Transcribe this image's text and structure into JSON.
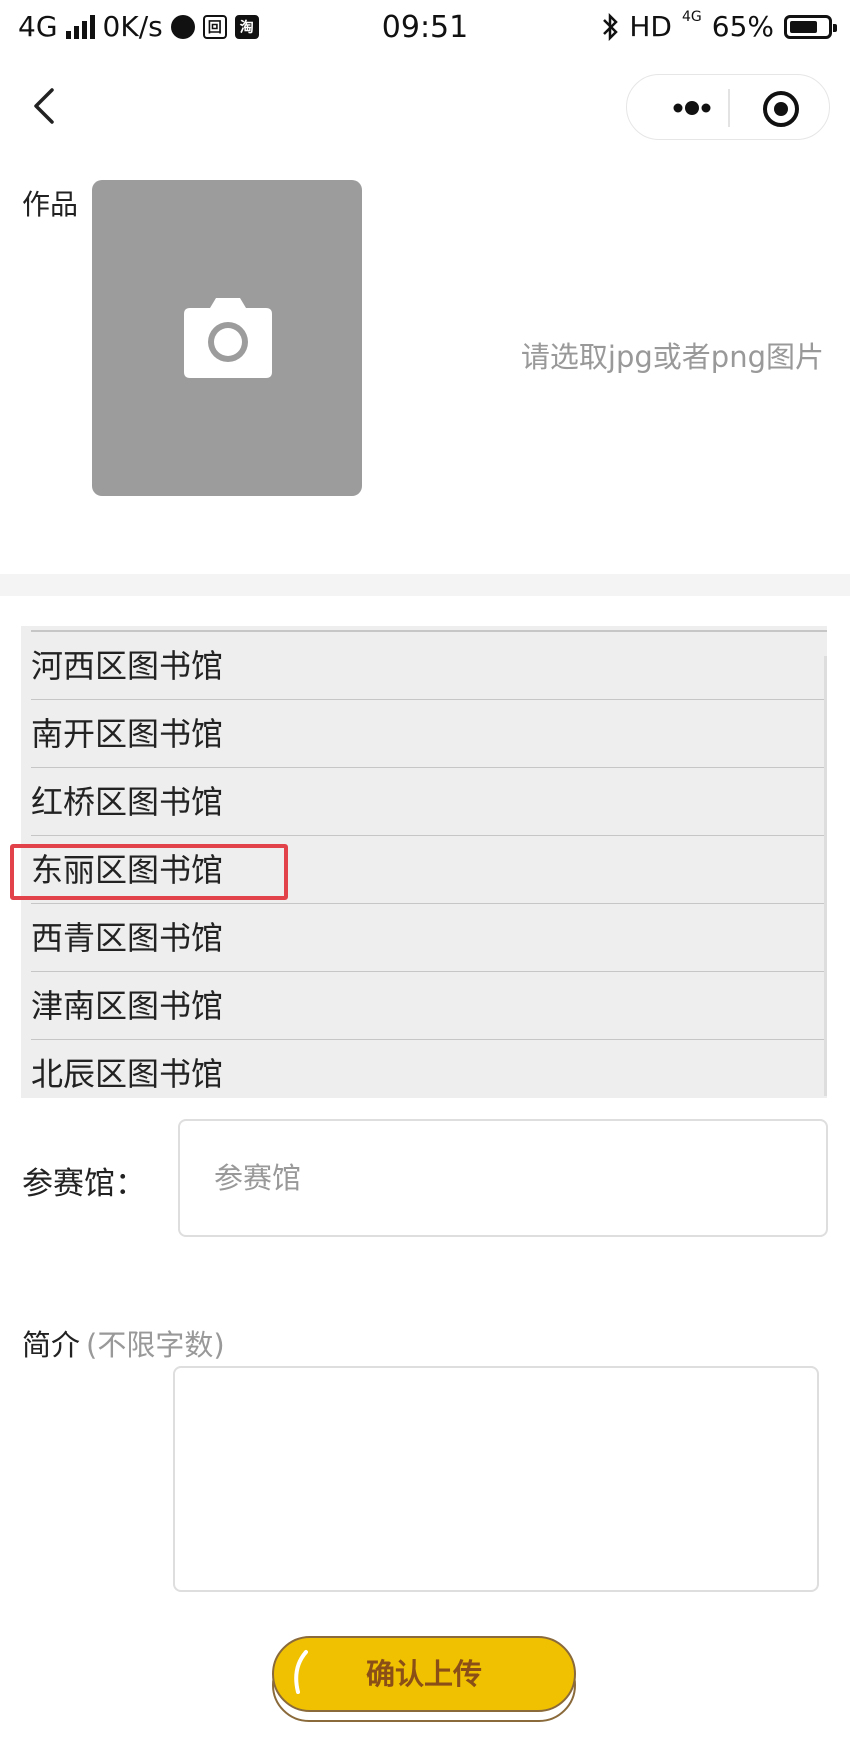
{
  "status_bar": {
    "network": "4G",
    "speed": "0K/s",
    "app_badge_1": "回",
    "app_badge_2": "淘",
    "time": "09:51",
    "hd": "HD",
    "net_small": "4G",
    "battery": "65%"
  },
  "upload": {
    "label": "作品",
    "hint": "请选取jpg或者png图片"
  },
  "picker": {
    "items": [
      "河西区图书馆",
      "南开区图书馆",
      "红桥区图书馆",
      "东丽区图书馆",
      "西青区图书馆",
      "津南区图书馆",
      "北辰区图书馆"
    ]
  },
  "venue": {
    "label": "参赛馆：",
    "placeholder": "参赛馆"
  },
  "intro": {
    "label": "简介",
    "note": "(不限字数)"
  },
  "confirm": {
    "label": "确认上传"
  },
  "colors": {
    "button_fill": "#f0c100",
    "button_text": "#8a4f17",
    "highlight": "#e2434b",
    "upload_bg": "#9c9c9c"
  }
}
